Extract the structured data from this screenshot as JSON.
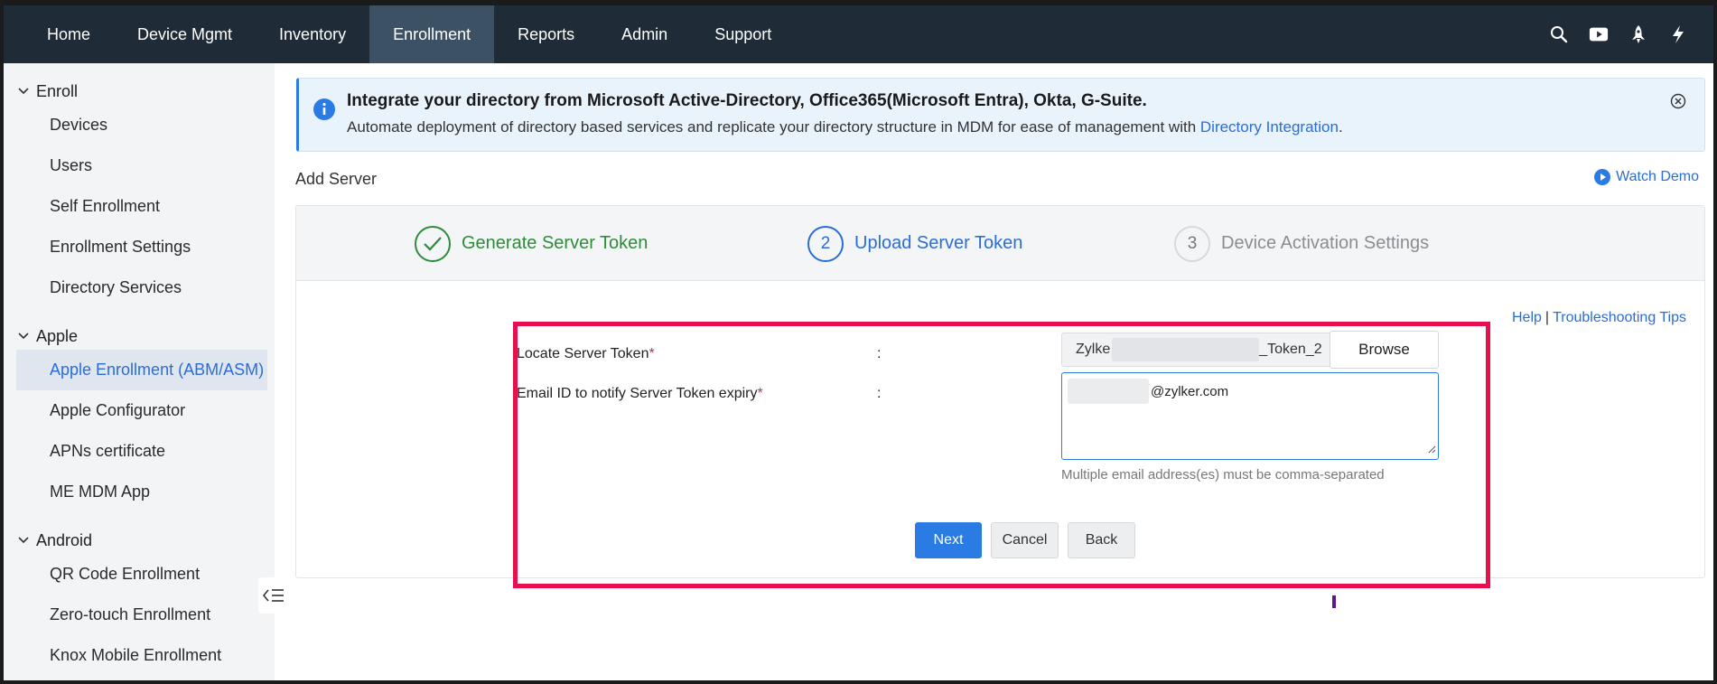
{
  "topnav": {
    "tabs": [
      {
        "label": "Home"
      },
      {
        "label": "Device Mgmt"
      },
      {
        "label": "Inventory"
      },
      {
        "label": "Enrollment",
        "active": true
      },
      {
        "label": "Reports"
      },
      {
        "label": "Admin"
      },
      {
        "label": "Support"
      }
    ],
    "icons": [
      "search-icon",
      "video-icon",
      "rocket-icon",
      "lightning-icon"
    ]
  },
  "sidebar": {
    "groups": [
      {
        "title": "Enroll",
        "items": [
          "Devices",
          "Users",
          "Self Enrollment",
          "Enrollment Settings",
          "Directory Services"
        ]
      },
      {
        "title": "Apple",
        "items": [
          "Apple Enrollment (ABM/ASM)",
          "Apple Configurator",
          "APNs certificate",
          "ME MDM App"
        ]
      },
      {
        "title": "Android",
        "items": [
          "QR Code Enrollment",
          "Zero-touch Enrollment",
          "Knox Mobile Enrollment"
        ]
      }
    ],
    "active_item": "Apple Enrollment (ABM/ASM)"
  },
  "banner": {
    "title": "Integrate your directory from Microsoft Active-Directory, Office365(Microsoft Entra), Okta, G-Suite.",
    "text_before_link": "Automate deployment of directory based services and replicate your directory structure in MDM for ease of management with ",
    "link": "Directory Integration",
    "text_after_link": "."
  },
  "page": {
    "title": "Add Server",
    "watch_demo": "Watch Demo"
  },
  "wizard": {
    "steps": [
      {
        "num": "",
        "label": "Generate Server Token",
        "state": "done"
      },
      {
        "num": "2",
        "label": "Upload Server Token",
        "state": "current"
      },
      {
        "num": "3",
        "label": "Device Activation Settings",
        "state": "pending"
      }
    ],
    "help": "Help",
    "help_sep": "|",
    "troubleshooting": "Troubleshooting Tips"
  },
  "form": {
    "token_label": "Locate Server Token",
    "email_label": "Email ID to notify Server Token expiry",
    "required_mark": "*",
    "colon": ":",
    "file_prefix": "Zylke",
    "file_suffix": "_Token_2",
    "browse": "Browse",
    "email_value": "@zylker.com",
    "email_hint": "Multiple email address(es) must be comma-separated"
  },
  "buttons": {
    "next": "Next",
    "cancel": "Cancel",
    "back": "Back"
  },
  "colors": {
    "nav_bg": "#1f2c38",
    "nav_active": "#3c5163",
    "accent": "#2a7be4",
    "success": "#2e8b3a",
    "highlight": "#e5104d"
  }
}
